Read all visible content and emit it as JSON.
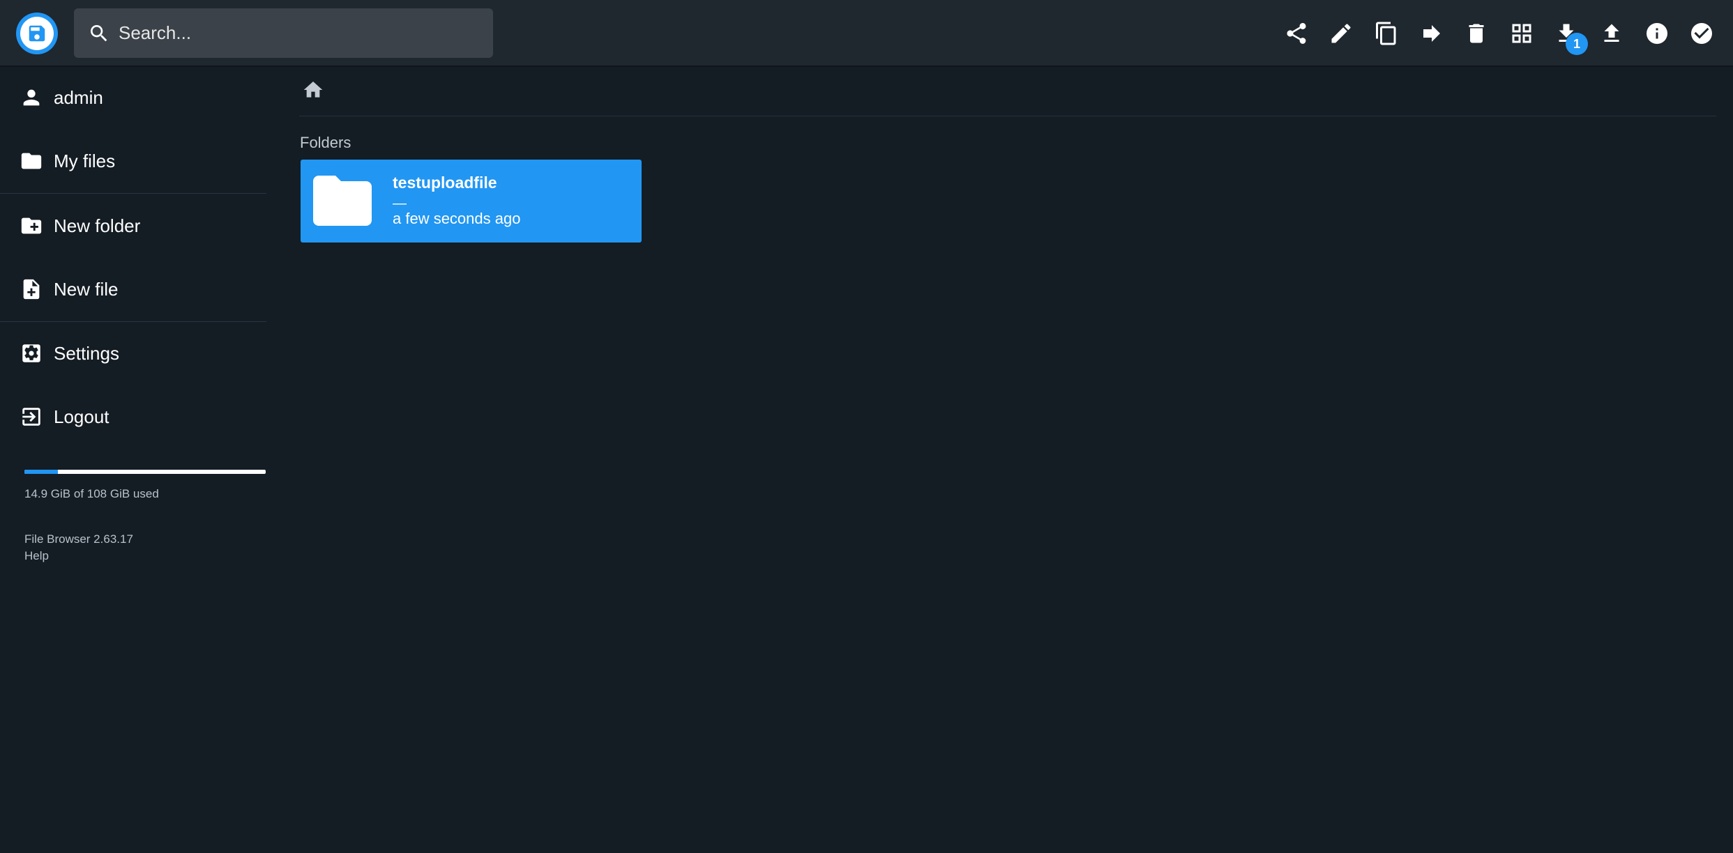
{
  "header": {
    "search": {
      "placeholder": "Search...",
      "value": ""
    },
    "toolbar": [
      {
        "name": "share-icon"
      },
      {
        "name": "rename-icon"
      },
      {
        "name": "copy-icon"
      },
      {
        "name": "move-icon"
      },
      {
        "name": "delete-icon"
      },
      {
        "name": "grid-view-icon"
      },
      {
        "name": "download-icon",
        "badge": "1"
      },
      {
        "name": "upload-icon"
      },
      {
        "name": "info-icon"
      },
      {
        "name": "select-icon"
      }
    ],
    "download_badge": "1"
  },
  "sidebar": {
    "user": "admin",
    "my_files": "My files",
    "new_folder": "New folder",
    "new_file": "New file",
    "settings": "Settings",
    "logout": "Logout",
    "usage_text": "14.9 GiB of 108 GiB used",
    "usage_fraction": 0.138,
    "version": "File Browser 2.63.17",
    "help": "Help"
  },
  "main": {
    "section_title": "Folders",
    "folders": [
      {
        "name": "testuploadfile",
        "size": "—",
        "modified": "a few seconds ago"
      }
    ]
  },
  "colors": {
    "accent": "#2196f3",
    "background": "#141c24",
    "header": "#1f272f",
    "search": "#3b4249"
  }
}
